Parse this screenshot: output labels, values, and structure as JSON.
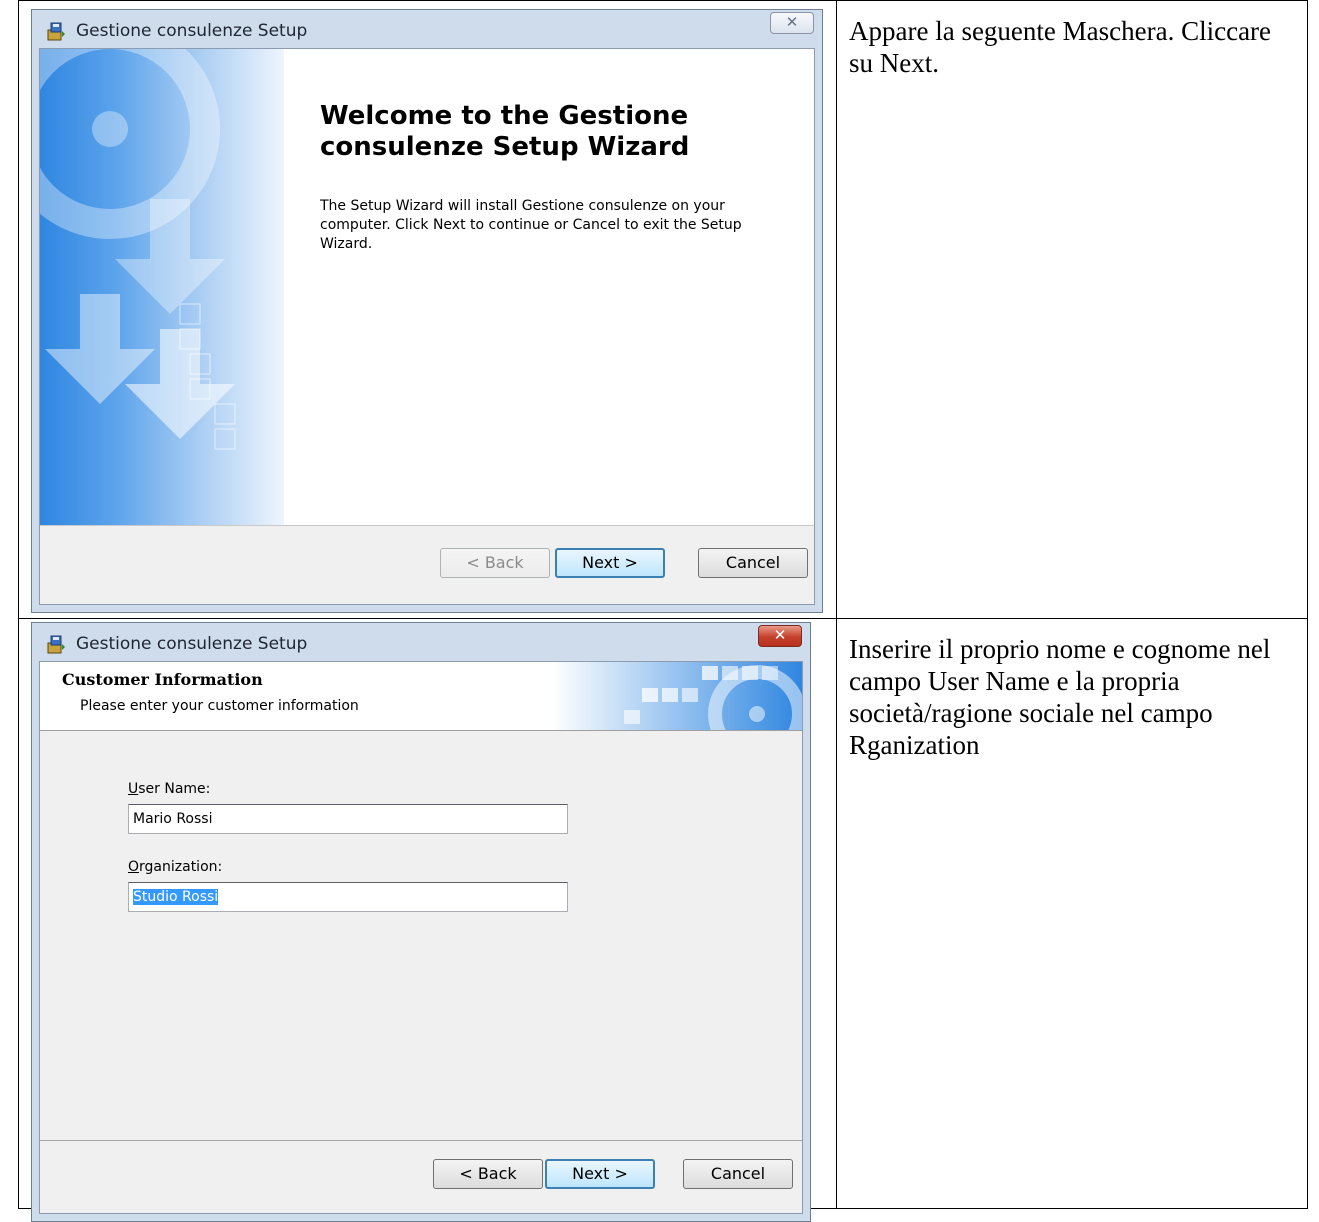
{
  "row1": {
    "window": {
      "title": "Gestione consulenze Setup",
      "close_glyph": "✕",
      "heading": "Welcome to the Gestione consulenze Setup Wizard",
      "body": "The Setup Wizard will install Gestione consulenze on your computer.  Click Next to continue or Cancel to exit the Setup Wizard.",
      "back_label": "< Back",
      "next_label": "Next >",
      "cancel_label": "Cancel"
    },
    "description": "Appare la seguente Maschera. Cliccare su Next."
  },
  "row2": {
    "window": {
      "title": "Gestione consulenze Setup",
      "close_glyph": "✕",
      "banner_title": "Customer Information",
      "banner_subtitle": "Please enter your customer information",
      "user_name_label_accel": "U",
      "user_name_label_rest": "ser Name:",
      "user_name_value": "Mario Rossi",
      "organization_label_accel": "O",
      "organization_label_rest": "rganization:",
      "organization_value": "Studio Rossi",
      "back_label": "< Back",
      "next_label": "Next >",
      "cancel_label": "Cancel"
    },
    "description": "Inserire il proprio nome e cognome nel campo User Name e la propria società/ragione sociale nel campo Rganization"
  },
  "icons": {
    "app": "installer-icon",
    "close": "close-icon"
  },
  "colors": {
    "default_button_border": "#3c7fb1",
    "close_red": "#c4412c",
    "selection": "#3399ff",
    "side_panel_blue": "#2f86e0"
  }
}
